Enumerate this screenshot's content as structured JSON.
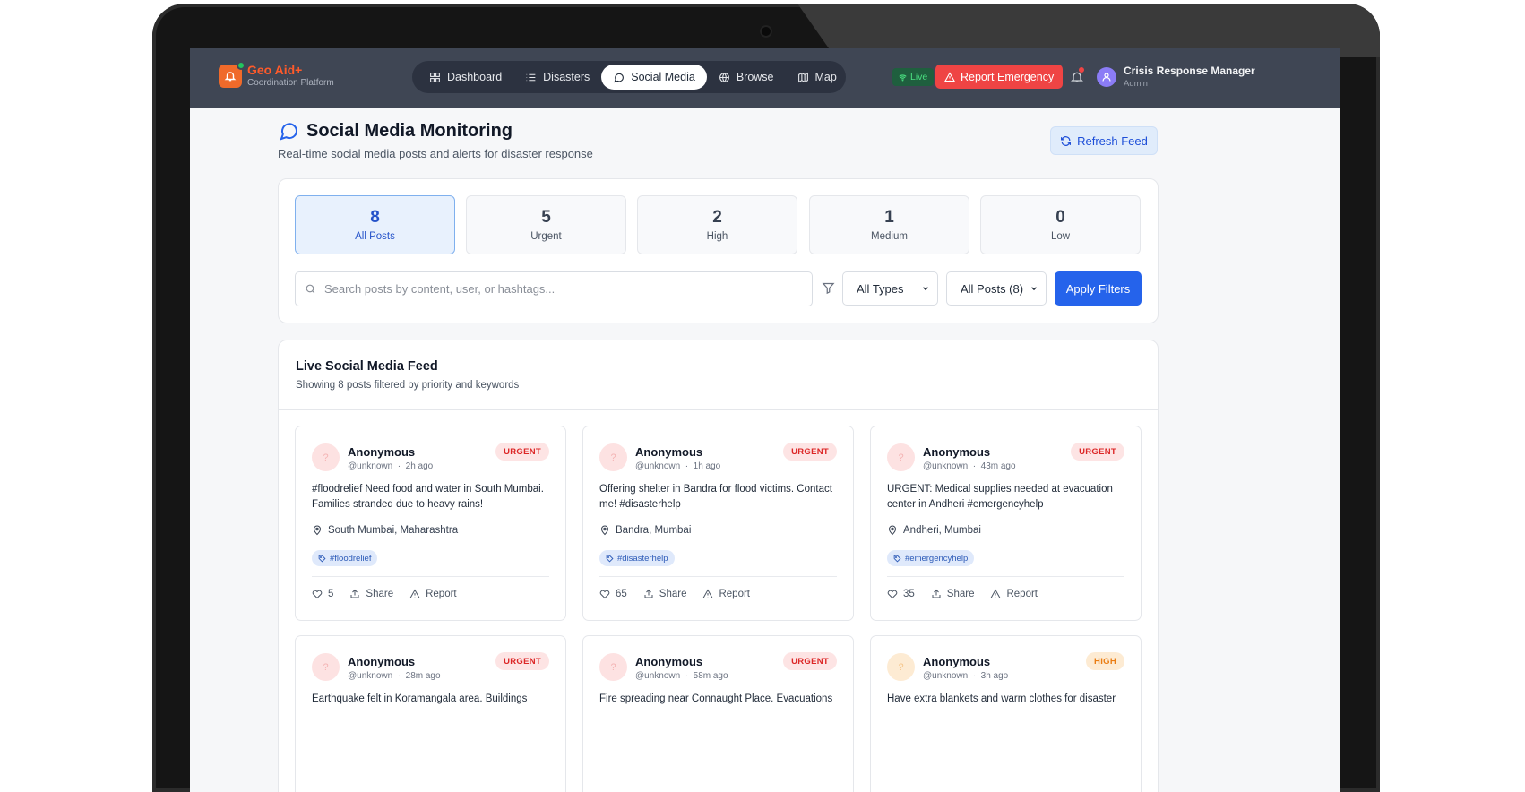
{
  "brand": {
    "name": "Geo Aid+",
    "subtitle": "Coordination Platform"
  },
  "nav": {
    "items": [
      {
        "label": "Dashboard",
        "icon": "grid-icon",
        "active": false
      },
      {
        "label": "Disasters",
        "icon": "list-icon",
        "active": false
      },
      {
        "label": "Social Media",
        "icon": "chat-bubble-icon",
        "active": true
      },
      {
        "label": "Browse",
        "icon": "globe-icon",
        "active": false
      },
      {
        "label": "Map",
        "icon": "map-icon",
        "active": false
      }
    ]
  },
  "header_right": {
    "live_label": "Live",
    "report_label": "Report Emergency",
    "user_name": "Crisis Response Manager",
    "user_role": "Admin"
  },
  "page": {
    "title": "Social Media Monitoring",
    "subtitle": "Real-time social media posts and alerts for disaster response",
    "refresh_label": "Refresh Feed"
  },
  "stats": [
    {
      "count": "8",
      "label": "All Posts",
      "active": true
    },
    {
      "count": "5",
      "label": "Urgent",
      "active": false
    },
    {
      "count": "2",
      "label": "High",
      "active": false
    },
    {
      "count": "1",
      "label": "Medium",
      "active": false
    },
    {
      "count": "0",
      "label": "Low",
      "active": false
    }
  ],
  "filters": {
    "search_placeholder": "Search posts by content, user, or hashtags...",
    "type_select": "All Types",
    "posts_select": "All Posts (8)",
    "apply_label": "Apply Filters"
  },
  "feed": {
    "title": "Live Social Media Feed",
    "subtitle": "Showing 8 posts filtered by priority and keywords",
    "posts": [
      {
        "user": "Anonymous",
        "handle": "@unknown",
        "time": "2h ago",
        "priority": "URGENT",
        "text": "#floodrelief Need food and water in South Mumbai. Families stranded due to heavy rains!",
        "location": "South Mumbai, Maharashtra",
        "tag": "#floodrelief",
        "likes": "5",
        "share_label": "Share",
        "report_label": "Report"
      },
      {
        "user": "Anonymous",
        "handle": "@unknown",
        "time": "1h ago",
        "priority": "URGENT",
        "text": "Offering shelter in Bandra for flood victims. Contact me! #disasterhelp",
        "location": "Bandra, Mumbai",
        "tag": "#disasterhelp",
        "likes": "65",
        "share_label": "Share",
        "report_label": "Report"
      },
      {
        "user": "Anonymous",
        "handle": "@unknown",
        "time": "43m ago",
        "priority": "URGENT",
        "text": "URGENT: Medical supplies needed at evacuation center in Andheri #emergencyhelp",
        "location": "Andheri, Mumbai",
        "tag": "#emergencyhelp",
        "likes": "35",
        "share_label": "Share",
        "report_label": "Report"
      },
      {
        "user": "Anonymous",
        "handle": "@unknown",
        "time": "28m ago",
        "priority": "URGENT",
        "text": "Earthquake felt in Koramangala area. Buildings",
        "location": "",
        "tag": "",
        "likes": "",
        "share_label": "",
        "report_label": ""
      },
      {
        "user": "Anonymous",
        "handle": "@unknown",
        "time": "58m ago",
        "priority": "URGENT",
        "text": "Fire spreading near Connaught Place. Evacuations",
        "location": "",
        "tag": "",
        "likes": "",
        "share_label": "",
        "report_label": ""
      },
      {
        "user": "Anonymous",
        "handle": "@unknown",
        "time": "3h ago",
        "priority": "HIGH",
        "text": "Have extra blankets and warm clothes for disaster",
        "location": "",
        "tag": "",
        "likes": "",
        "share_label": "",
        "report_label": ""
      }
    ]
  },
  "colors": {
    "navbar": "#3f4654",
    "accent": "#2563eb",
    "urgent": "#dc2626",
    "high": "#ea7d13",
    "brand": "#ff5a2a"
  }
}
